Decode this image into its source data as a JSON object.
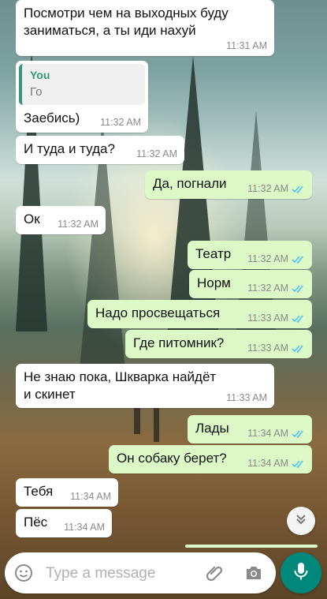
{
  "messages": [
    {
      "id": "m1",
      "dir": "in",
      "text": "Посмотри чем на выходных буду\nзаниматься, а ты иди нахуй",
      "time": "11:31 AM"
    },
    {
      "id": "m2",
      "dir": "in",
      "quote_author": "You",
      "quote_text": "Го",
      "text": "Заебись)",
      "time": "11:32 AM"
    },
    {
      "id": "m3",
      "dir": "in",
      "text": "И туда и туда?",
      "time": "11:32 AM"
    },
    {
      "id": "m4",
      "dir": "out",
      "text": "Да, погнали",
      "time": "11:32 AM"
    },
    {
      "id": "m5",
      "dir": "in",
      "text": "Ок",
      "time": "11:32 AM"
    },
    {
      "id": "m6",
      "dir": "out",
      "text": "Театр",
      "time": "11:32 AM"
    },
    {
      "id": "m7",
      "dir": "out",
      "text": "Норм",
      "time": "11:32 AM"
    },
    {
      "id": "m8",
      "dir": "out",
      "text": "Надо просвещаться",
      "time": "11:33 AM"
    },
    {
      "id": "m9",
      "dir": "out",
      "text": "Где питомник?",
      "time": "11:33 AM"
    },
    {
      "id": "m10",
      "dir": "in",
      "text": "Не знаю пока, Шкварка найдёт\nи скинет",
      "time": "11:33 AM"
    },
    {
      "id": "m11",
      "dir": "out",
      "text": "Лады",
      "time": "11:34 AM"
    },
    {
      "id": "m12",
      "dir": "out",
      "text": "Он собаку берет?",
      "time": "11:34 AM"
    },
    {
      "id": "m13",
      "dir": "in",
      "text": "Тебя",
      "time": "11:34 AM"
    },
    {
      "id": "m14",
      "dir": "in",
      "text": "Пёс",
      "time": "11:34 AM"
    }
  ],
  "composer": {
    "placeholder": "Type a message",
    "icons": [
      "emoji-icon",
      "paperclip-icon",
      "camera-icon",
      "microphone-icon"
    ]
  },
  "colors": {
    "outgoing_bubble": "#dcf8c6",
    "incoming_bubble": "#ffffff",
    "read_ticks": "#4fc3f7",
    "accent": "#00897b",
    "quote_accent": "#35987a"
  }
}
